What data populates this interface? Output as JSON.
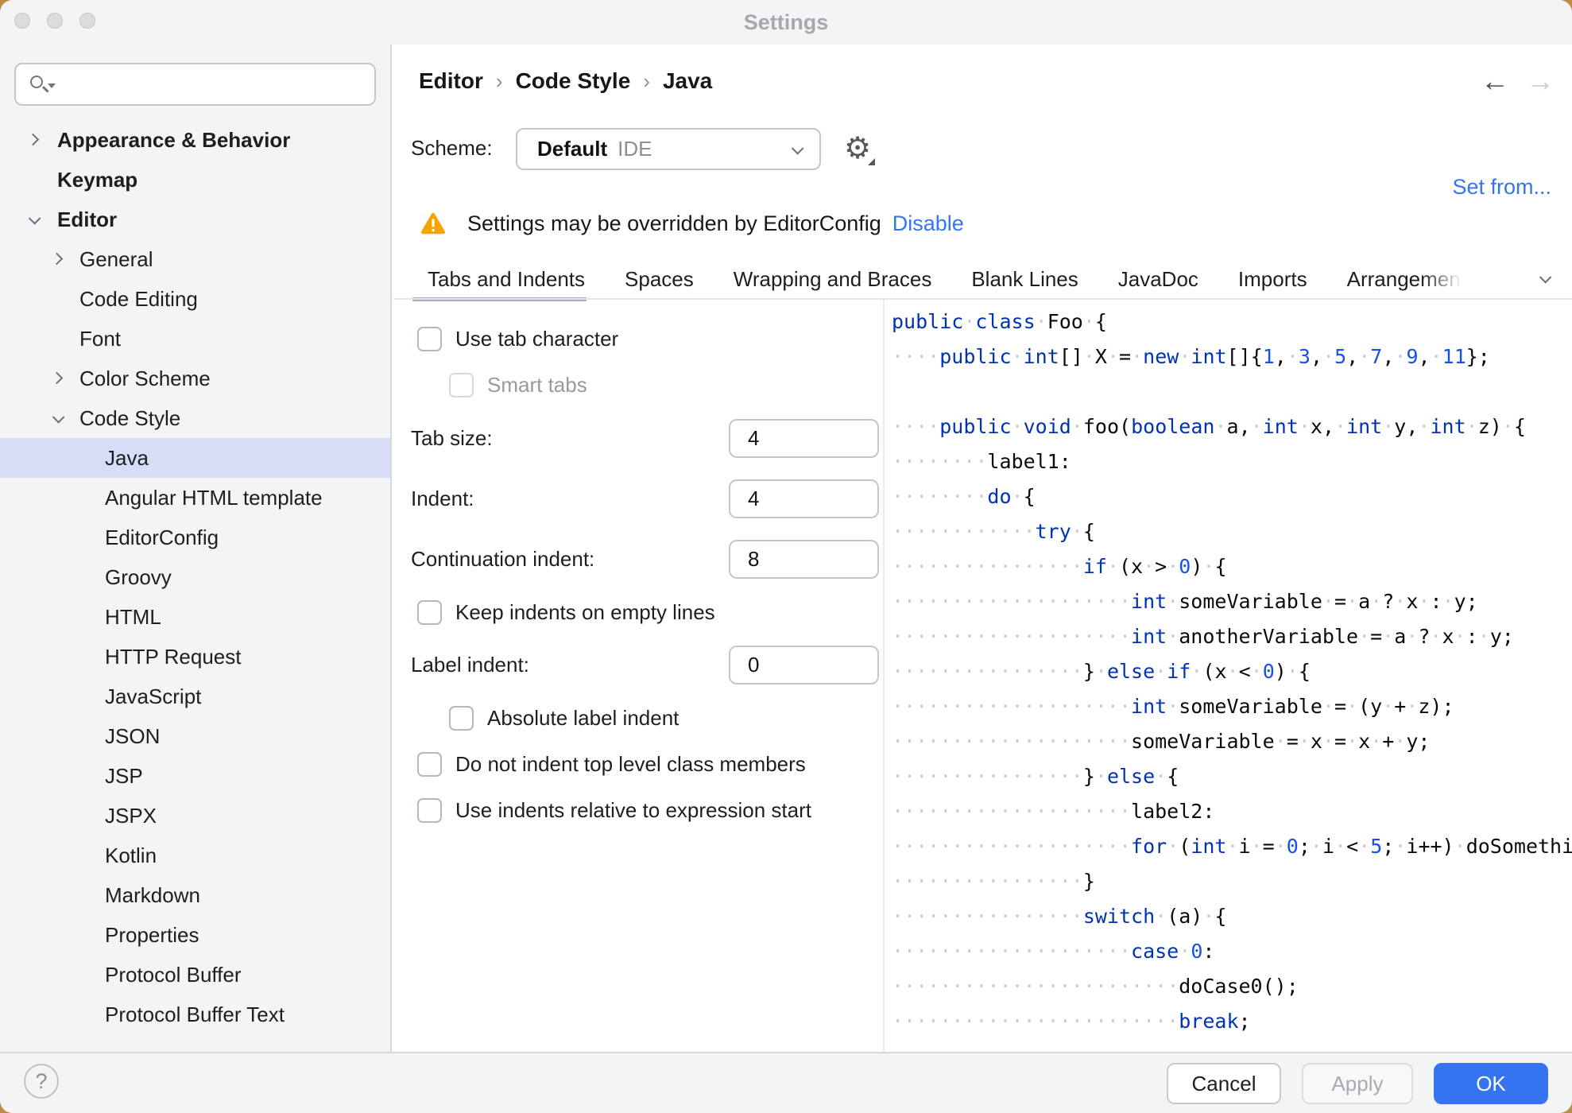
{
  "window": {
    "title": "Settings"
  },
  "sidebar": {
    "search": {
      "placeholder": ""
    },
    "items": [
      {
        "label": "Appearance & Behavior",
        "level": 0,
        "bold": true,
        "chevron": "right"
      },
      {
        "label": "Keymap",
        "level": 0,
        "bold": true,
        "chevron": null
      },
      {
        "label": "Editor",
        "level": 0,
        "bold": true,
        "chevron": "down"
      },
      {
        "label": "General",
        "level": 1,
        "bold": false,
        "chevron": "right"
      },
      {
        "label": "Code Editing",
        "level": 1,
        "bold": false,
        "chevron": null
      },
      {
        "label": "Font",
        "level": 1,
        "bold": false,
        "chevron": null
      },
      {
        "label": "Color Scheme",
        "level": 1,
        "bold": false,
        "chevron": "right"
      },
      {
        "label": "Code Style",
        "level": 1,
        "bold": false,
        "chevron": "down"
      },
      {
        "label": "Java",
        "level": 2,
        "bold": false,
        "chevron": null,
        "selected": true
      },
      {
        "label": "Angular HTML template",
        "level": 2,
        "bold": false,
        "chevron": null
      },
      {
        "label": "EditorConfig",
        "level": 2,
        "bold": false,
        "chevron": null
      },
      {
        "label": "Groovy",
        "level": 2,
        "bold": false,
        "chevron": null
      },
      {
        "label": "HTML",
        "level": 2,
        "bold": false,
        "chevron": null
      },
      {
        "label": "HTTP Request",
        "level": 2,
        "bold": false,
        "chevron": null
      },
      {
        "label": "JavaScript",
        "level": 2,
        "bold": false,
        "chevron": null
      },
      {
        "label": "JSON",
        "level": 2,
        "bold": false,
        "chevron": null
      },
      {
        "label": "JSP",
        "level": 2,
        "bold": false,
        "chevron": null
      },
      {
        "label": "JSPX",
        "level": 2,
        "bold": false,
        "chevron": null
      },
      {
        "label": "Kotlin",
        "level": 2,
        "bold": false,
        "chevron": null
      },
      {
        "label": "Markdown",
        "level": 2,
        "bold": false,
        "chevron": null
      },
      {
        "label": "Properties",
        "level": 2,
        "bold": false,
        "chevron": null
      },
      {
        "label": "Protocol Buffer",
        "level": 2,
        "bold": false,
        "chevron": null
      },
      {
        "label": "Protocol Buffer Text",
        "level": 2,
        "bold": false,
        "chevron": null
      }
    ]
  },
  "header": {
    "breadcrumb": {
      "items": [
        "Editor",
        "Code Style",
        "Java"
      ],
      "separator": "›"
    },
    "nav": {
      "back": "←",
      "forward": "→"
    },
    "scheme": {
      "label": "Scheme:",
      "value": "Default",
      "suffix": "IDE"
    },
    "set_from": "Set from...",
    "banner": {
      "text": "Settings may be overridden by EditorConfig",
      "action": "Disable"
    }
  },
  "tabs": {
    "items": [
      {
        "label": "Tabs and Indents",
        "selected": true
      },
      {
        "label": "Spaces"
      },
      {
        "label": "Wrapping and Braces"
      },
      {
        "label": "Blank Lines"
      },
      {
        "label": "JavaDoc"
      },
      {
        "label": "Imports"
      },
      {
        "label": "Arrangement",
        "truncated": true
      }
    ]
  },
  "form": {
    "rows": [
      {
        "type": "checkbox",
        "label": "Use tab character",
        "checked": false,
        "indent": 0
      },
      {
        "type": "checkbox",
        "label": "Smart tabs",
        "checked": false,
        "indent": 1,
        "disabled": true
      },
      {
        "type": "number",
        "label": "Tab size:",
        "value": "4"
      },
      {
        "type": "number",
        "label": "Indent:",
        "value": "4"
      },
      {
        "type": "number",
        "label": "Continuation indent:",
        "value": "8"
      },
      {
        "type": "checkbox",
        "label": "Keep indents on empty lines",
        "checked": false,
        "indent": 0
      },
      {
        "type": "number",
        "label": "Label indent:",
        "value": "0"
      },
      {
        "type": "checkbox",
        "label": "Absolute label indent",
        "checked": false,
        "indent": 1
      },
      {
        "type": "checkbox",
        "label": "Do not indent top level class members",
        "checked": false,
        "indent": 0
      },
      {
        "type": "checkbox",
        "label": "Use indents relative to expression start",
        "checked": false,
        "indent": 0
      }
    ]
  },
  "code": {
    "colors": {
      "keyword": "#0033B3",
      "number": "#1750EB",
      "plain": "#0a0a0a",
      "whitespace": "#c9ccd3"
    },
    "lines": [
      [
        [
          "k",
          "public"
        ],
        [
          "t",
          " "
        ],
        [
          "k",
          "class"
        ],
        [
          "t",
          " Foo {"
        ]
      ],
      [
        [
          "t",
          "    "
        ],
        [
          "k",
          "public"
        ],
        [
          "t",
          " "
        ],
        [
          "k",
          "int"
        ],
        [
          "t",
          "[] X = "
        ],
        [
          "k",
          "new"
        ],
        [
          "t",
          " "
        ],
        [
          "k",
          "int"
        ],
        [
          "t",
          "[]{"
        ],
        [
          "n",
          "1"
        ],
        [
          "t",
          ", "
        ],
        [
          "n",
          "3"
        ],
        [
          "t",
          ", "
        ],
        [
          "n",
          "5"
        ],
        [
          "t",
          ", "
        ],
        [
          "n",
          "7"
        ],
        [
          "t",
          ", "
        ],
        [
          "n",
          "9"
        ],
        [
          "t",
          ", "
        ],
        [
          "n",
          "11"
        ],
        [
          "t",
          "};"
        ]
      ],
      [],
      [
        [
          "t",
          "    "
        ],
        [
          "k",
          "public"
        ],
        [
          "t",
          " "
        ],
        [
          "k",
          "void"
        ],
        [
          "t",
          " foo("
        ],
        [
          "k",
          "boolean"
        ],
        [
          "t",
          " a, "
        ],
        [
          "k",
          "int"
        ],
        [
          "t",
          " x, "
        ],
        [
          "k",
          "int"
        ],
        [
          "t",
          " y, "
        ],
        [
          "k",
          "int"
        ],
        [
          "t",
          " z) {"
        ]
      ],
      [
        [
          "t",
          "        label1:"
        ]
      ],
      [
        [
          "t",
          "        "
        ],
        [
          "k",
          "do"
        ],
        [
          "t",
          " {"
        ]
      ],
      [
        [
          "t",
          "            "
        ],
        [
          "k",
          "try"
        ],
        [
          "t",
          " {"
        ]
      ],
      [
        [
          "t",
          "                "
        ],
        [
          "k",
          "if"
        ],
        [
          "t",
          " (x > "
        ],
        [
          "n",
          "0"
        ],
        [
          "t",
          ") {"
        ]
      ],
      [
        [
          "t",
          "                    "
        ],
        [
          "k",
          "int"
        ],
        [
          "t",
          " someVariable = a ? x : y;"
        ]
      ],
      [
        [
          "t",
          "                    "
        ],
        [
          "k",
          "int"
        ],
        [
          "t",
          " anotherVariable = a ? x : y;"
        ]
      ],
      [
        [
          "t",
          "                } "
        ],
        [
          "k",
          "else"
        ],
        [
          "t",
          " "
        ],
        [
          "k",
          "if"
        ],
        [
          "t",
          " (x < "
        ],
        [
          "n",
          "0"
        ],
        [
          "t",
          ") {"
        ]
      ],
      [
        [
          "t",
          "                    "
        ],
        [
          "k",
          "int"
        ],
        [
          "t",
          " someVariable = (y + z);"
        ]
      ],
      [
        [
          "t",
          "                    someVariable = x = x + y;"
        ]
      ],
      [
        [
          "t",
          "                } "
        ],
        [
          "k",
          "else"
        ],
        [
          "t",
          " {"
        ]
      ],
      [
        [
          "t",
          "                    label2:"
        ]
      ],
      [
        [
          "t",
          "                    "
        ],
        [
          "k",
          "for"
        ],
        [
          "t",
          " ("
        ],
        [
          "k",
          "int"
        ],
        [
          "t",
          " i = "
        ],
        [
          "n",
          "0"
        ],
        [
          "t",
          "; i < "
        ],
        [
          "n",
          "5"
        ],
        [
          "t",
          "; i++) doSomething(i);"
        ]
      ],
      [
        [
          "t",
          "                }"
        ]
      ],
      [
        [
          "t",
          "                "
        ],
        [
          "k",
          "switch"
        ],
        [
          "t",
          " (a) {"
        ]
      ],
      [
        [
          "t",
          "                    "
        ],
        [
          "k",
          "case"
        ],
        [
          "t",
          " "
        ],
        [
          "n",
          "0"
        ],
        [
          "t",
          ":"
        ]
      ],
      [
        [
          "t",
          "                        doCase0();"
        ]
      ],
      [
        [
          "t",
          "                        "
        ],
        [
          "k",
          "break"
        ],
        [
          "t",
          ";"
        ]
      ]
    ]
  },
  "footer": {
    "help": "?",
    "cancel": "Cancel",
    "apply": "Apply",
    "ok": "OK"
  },
  "colors": {
    "accent": "#3574F0",
    "selection": "#d7ddf6",
    "warning": "#F5A300",
    "keyword": "#0033B3",
    "number": "#1750EB"
  }
}
